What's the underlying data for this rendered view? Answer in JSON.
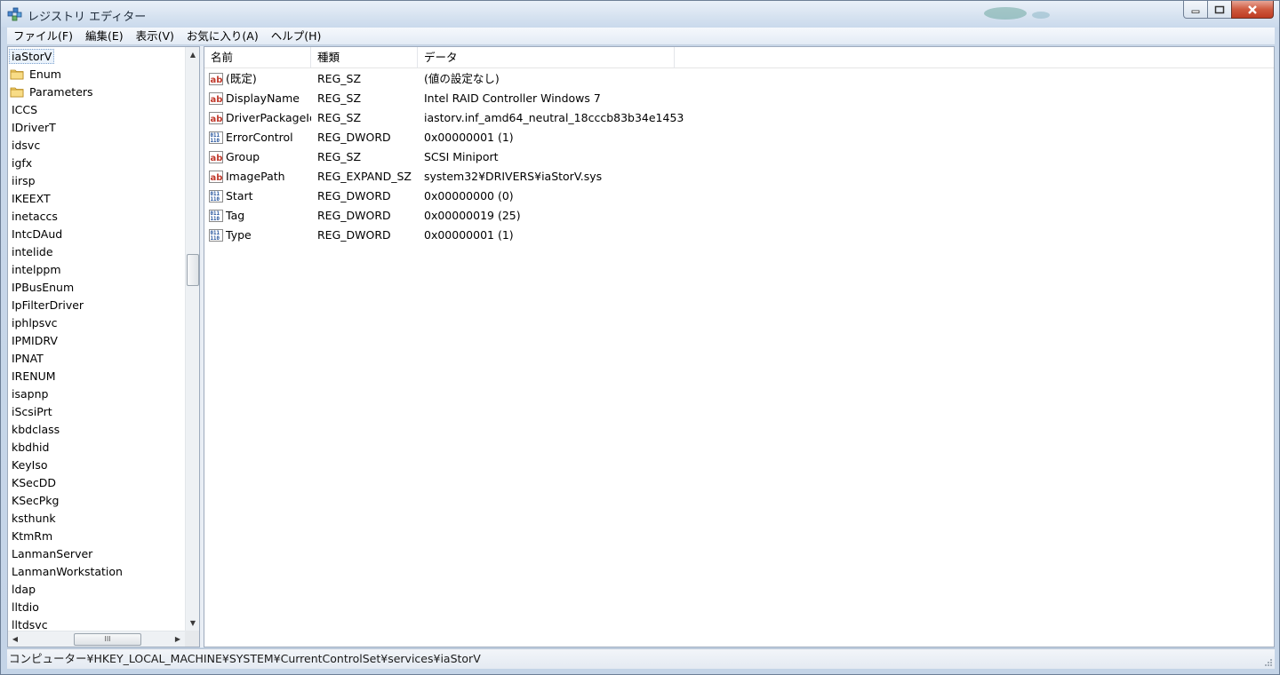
{
  "window": {
    "title": "レジストリ エディター",
    "controls": {
      "minimize": "minimize",
      "maximize": "maximize",
      "close": "close"
    }
  },
  "menu": [
    "ファイル(F)",
    "編集(E)",
    "表示(V)",
    "お気に入り(A)",
    "ヘルプ(H)"
  ],
  "tree": {
    "selected": "iaStorV",
    "children": [
      "Enum",
      "Parameters"
    ],
    "siblings": [
      "ICCS",
      "IDriverT",
      "idsvc",
      "igfx",
      "iirsp",
      "IKEEXT",
      "inetaccs",
      "IntcDAud",
      "intelide",
      "intelppm",
      "IPBusEnum",
      "IpFilterDriver",
      "iphlpsvc",
      "IPMIDRV",
      "IPNAT",
      "IRENUM",
      "isapnp",
      "iScsiPrt",
      "kbdclass",
      "kbdhid",
      "KeyIso",
      "KSecDD",
      "KSecPkg",
      "ksthunk",
      "KtmRm",
      "LanmanServer",
      "LanmanWorkstation",
      "ldap",
      "lltdio",
      "lltdsvc"
    ],
    "hscroll_grip": "III"
  },
  "columns": {
    "name": "名前",
    "type": "種類",
    "data": "データ"
  },
  "values": [
    {
      "icon": "string-value-icon",
      "name": "(既定)",
      "type": "REG_SZ",
      "data": "(値の設定なし)"
    },
    {
      "icon": "string-value-icon",
      "name": "DisplayName",
      "type": "REG_SZ",
      "data": "Intel RAID Controller Windows 7"
    },
    {
      "icon": "string-value-icon",
      "name": "DriverPackageId",
      "type": "REG_SZ",
      "data": "iastorv.inf_amd64_neutral_18cccb83b34e1453"
    },
    {
      "icon": "dword-value-icon",
      "name": "ErrorControl",
      "type": "REG_DWORD",
      "data": "0x00000001 (1)"
    },
    {
      "icon": "string-value-icon",
      "name": "Group",
      "type": "REG_SZ",
      "data": "SCSI Miniport"
    },
    {
      "icon": "string-value-icon",
      "name": "ImagePath",
      "type": "REG_EXPAND_SZ",
      "data": "system32¥DRIVERS¥iaStorV.sys"
    },
    {
      "icon": "dword-value-icon",
      "name": "Start",
      "type": "REG_DWORD",
      "data": "0x00000000 (0)"
    },
    {
      "icon": "dword-value-icon",
      "name": "Tag",
      "type": "REG_DWORD",
      "data": "0x00000019 (25)"
    },
    {
      "icon": "dword-value-icon",
      "name": "Type",
      "type": "REG_DWORD",
      "data": "0x00000001 (1)"
    }
  ],
  "status": "コンピューター¥HKEY_LOCAL_MACHINE¥SYSTEM¥CurrentControlSet¥services¥iaStorV",
  "colors": {
    "title_bg": "#d6e2f0",
    "close_red": "#cf5a3f",
    "selection_outline": "#7da2ce"
  }
}
